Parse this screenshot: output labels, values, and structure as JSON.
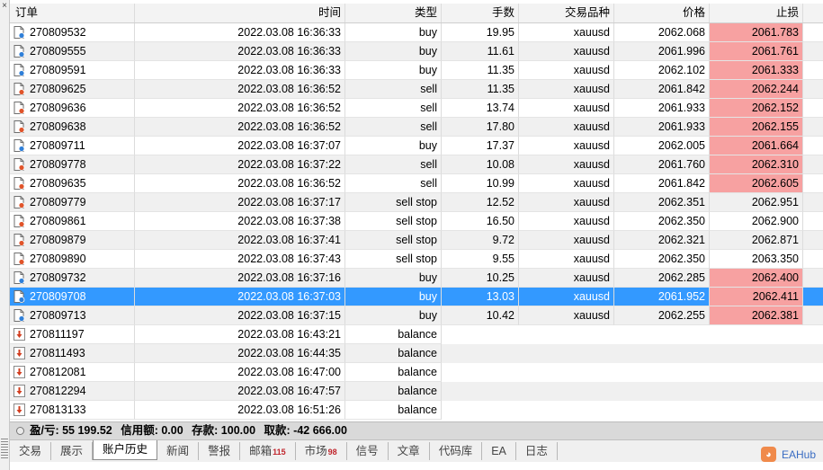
{
  "columns": {
    "order": "订单",
    "time": "时间",
    "type": "类型",
    "volume": "手数",
    "symbol": "交易品种",
    "price": "价格",
    "stop_loss": "止损"
  },
  "rows": [
    {
      "order": "270809532",
      "time": "2022.03.08 16:36:33",
      "type": "buy",
      "volume": "19.95",
      "symbol": "xauusd",
      "price": "2062.068",
      "stop_loss": "2061.783",
      "sl_highlight": true,
      "icon": "buy-order-icon"
    },
    {
      "order": "270809555",
      "time": "2022.03.08 16:36:33",
      "type": "buy",
      "volume": "11.61",
      "symbol": "xauusd",
      "price": "2061.996",
      "stop_loss": "2061.761",
      "sl_highlight": true,
      "icon": "buy-order-icon"
    },
    {
      "order": "270809591",
      "time": "2022.03.08 16:36:33",
      "type": "buy",
      "volume": "11.35",
      "symbol": "xauusd",
      "price": "2062.102",
      "stop_loss": "2061.333",
      "sl_highlight": true,
      "icon": "buy-order-icon"
    },
    {
      "order": "270809625",
      "time": "2022.03.08 16:36:52",
      "type": "sell",
      "volume": "11.35",
      "symbol": "xauusd",
      "price": "2061.842",
      "stop_loss": "2062.244",
      "sl_highlight": true,
      "icon": "sell-order-icon"
    },
    {
      "order": "270809636",
      "time": "2022.03.08 16:36:52",
      "type": "sell",
      "volume": "13.74",
      "symbol": "xauusd",
      "price": "2061.933",
      "stop_loss": "2062.152",
      "sl_highlight": true,
      "icon": "sell-order-icon"
    },
    {
      "order": "270809638",
      "time": "2022.03.08 16:36:52",
      "type": "sell",
      "volume": "17.80",
      "symbol": "xauusd",
      "price": "2061.933",
      "stop_loss": "2062.155",
      "sl_highlight": true,
      "icon": "sell-order-icon"
    },
    {
      "order": "270809711",
      "time": "2022.03.08 16:37:07",
      "type": "buy",
      "volume": "17.37",
      "symbol": "xauusd",
      "price": "2062.005",
      "stop_loss": "2061.664",
      "sl_highlight": true,
      "icon": "buy-order-icon"
    },
    {
      "order": "270809778",
      "time": "2022.03.08 16:37:22",
      "type": "sell",
      "volume": "10.08",
      "symbol": "xauusd",
      "price": "2061.760",
      "stop_loss": "2062.310",
      "sl_highlight": true,
      "icon": "sell-order-icon"
    },
    {
      "order": "270809635",
      "time": "2022.03.08 16:36:52",
      "type": "sell",
      "volume": "10.99",
      "symbol": "xauusd",
      "price": "2061.842",
      "stop_loss": "2062.605",
      "sl_highlight": true,
      "icon": "sell-order-icon"
    },
    {
      "order": "270809779",
      "time": "2022.03.08 16:37:17",
      "type": "sell stop",
      "volume": "12.52",
      "symbol": "xauusd",
      "price": "2062.351",
      "stop_loss": "2062.951",
      "sl_highlight": false,
      "icon": "sell-order-icon"
    },
    {
      "order": "270809861",
      "time": "2022.03.08 16:37:38",
      "type": "sell stop",
      "volume": "16.50",
      "symbol": "xauusd",
      "price": "2062.350",
      "stop_loss": "2062.900",
      "sl_highlight": false,
      "icon": "sell-order-icon"
    },
    {
      "order": "270809879",
      "time": "2022.03.08 16:37:41",
      "type": "sell stop",
      "volume": "9.72",
      "symbol": "xauusd",
      "price": "2062.321",
      "stop_loss": "2062.871",
      "sl_highlight": false,
      "icon": "sell-order-icon"
    },
    {
      "order": "270809890",
      "time": "2022.03.08 16:37:43",
      "type": "sell stop",
      "volume": "9.55",
      "symbol": "xauusd",
      "price": "2062.350",
      "stop_loss": "2063.350",
      "sl_highlight": false,
      "icon": "sell-order-icon"
    },
    {
      "order": "270809732",
      "time": "2022.03.08 16:37:16",
      "type": "buy",
      "volume": "10.25",
      "symbol": "xauusd",
      "price": "2062.285",
      "stop_loss": "2062.400",
      "sl_highlight": true,
      "icon": "buy-order-icon"
    },
    {
      "order": "270809708",
      "time": "2022.03.08 16:37:03",
      "type": "buy",
      "volume": "13.03",
      "symbol": "xauusd",
      "price": "2061.952",
      "stop_loss": "2062.411",
      "sl_highlight": true,
      "icon": "buy-order-icon",
      "selected": true
    },
    {
      "order": "270809713",
      "time": "2022.03.08 16:37:15",
      "type": "buy",
      "volume": "10.42",
      "symbol": "xauusd",
      "price": "2062.255",
      "stop_loss": "2062.381",
      "sl_highlight": true,
      "icon": "buy-order-icon"
    },
    {
      "order": "270811197",
      "time": "2022.03.08 16:43:21",
      "type": "balance",
      "icon": "balance-icon"
    },
    {
      "order": "270811493",
      "time": "2022.03.08 16:44:35",
      "type": "balance",
      "icon": "balance-icon"
    },
    {
      "order": "270812081",
      "time": "2022.03.08 16:47:00",
      "type": "balance",
      "icon": "balance-icon"
    },
    {
      "order": "270812294",
      "time": "2022.03.08 16:47:57",
      "type": "balance",
      "icon": "balance-icon"
    },
    {
      "order": "270813133",
      "time": "2022.03.08 16:51:26",
      "type": "balance",
      "icon": "balance-icon"
    }
  ],
  "summary": {
    "profit": "盈/亏: 55 199.52",
    "credit": "信用额: 0.00",
    "deposit": "存款: 100.00",
    "withdrawal": "取款: -42 666.00"
  },
  "tabs": [
    {
      "label": "交易",
      "badge": ""
    },
    {
      "label": "展示",
      "badge": ""
    },
    {
      "label": "账户历史",
      "badge": "",
      "active": true
    },
    {
      "label": "新闻",
      "badge": ""
    },
    {
      "label": "警报",
      "badge": ""
    },
    {
      "label": "邮箱",
      "badge": "115"
    },
    {
      "label": "市场",
      "badge": "98"
    },
    {
      "label": "信号",
      "badge": ""
    },
    {
      "label": "文章",
      "badge": ""
    },
    {
      "label": "代码库",
      "badge": ""
    },
    {
      "label": "EA",
      "badge": ""
    },
    {
      "label": "日志",
      "badge": ""
    }
  ],
  "watermark": "EAHub"
}
